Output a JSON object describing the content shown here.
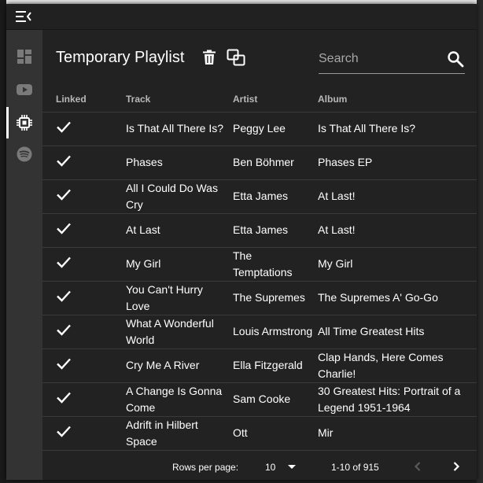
{
  "header": {
    "title": "Temporary Playlist",
    "search_placeholder": "Search"
  },
  "sidebar": {
    "items": [
      {
        "name": "dashboard",
        "icon": "dashboard-icon"
      },
      {
        "name": "youtube",
        "icon": "youtube-icon"
      },
      {
        "name": "chip",
        "icon": "chip-icon",
        "active": true
      },
      {
        "name": "spotify",
        "icon": "spotify-icon"
      }
    ]
  },
  "table": {
    "columns": [
      "Linked",
      "Track",
      "Artist",
      "Album"
    ],
    "rows": [
      {
        "linked": true,
        "track": "Is That All There Is?",
        "artist": "Peggy Lee",
        "album": "Is That All There Is?"
      },
      {
        "linked": true,
        "track": "Phases",
        "artist": "Ben Böhmer",
        "album": "Phases EP"
      },
      {
        "linked": true,
        "track": "All I Could Do Was Cry",
        "artist": "Etta James",
        "album": "At Last!"
      },
      {
        "linked": true,
        "track": "At Last",
        "artist": "Etta James",
        "album": "At Last!"
      },
      {
        "linked": true,
        "track": "My Girl",
        "artist": "The Temptations",
        "album": "My Girl"
      },
      {
        "linked": true,
        "track": "You Can't Hurry Love",
        "artist": "The Supremes",
        "album": "The Supremes A' Go-Go"
      },
      {
        "linked": true,
        "track": "What A Wonderful World",
        "artist": "Louis Armstrong",
        "album": "All Time Greatest Hits"
      },
      {
        "linked": true,
        "track": "Cry Me A River",
        "artist": "Ella Fitzgerald",
        "album": "Clap Hands, Here Comes Charlie!"
      },
      {
        "linked": true,
        "track": "A Change Is Gonna Come",
        "artist": "Sam Cooke",
        "album": "30 Greatest Hits: Portrait of a Legend 1951-1964"
      },
      {
        "linked": true,
        "track": "Adrift in Hilbert Space",
        "artist": "Ott",
        "album": "Mir"
      }
    ]
  },
  "footer": {
    "rows_per_page_label": "Rows per page:",
    "rows_per_page_value": "10",
    "range": "1-10 of 915"
  },
  "colors": {
    "background": "#222222",
    "sidebar": "#333333",
    "titlebar": "#212121",
    "text": "#ffffff",
    "muted": "#b8b8b8",
    "disabled": "#5a5a5a"
  }
}
